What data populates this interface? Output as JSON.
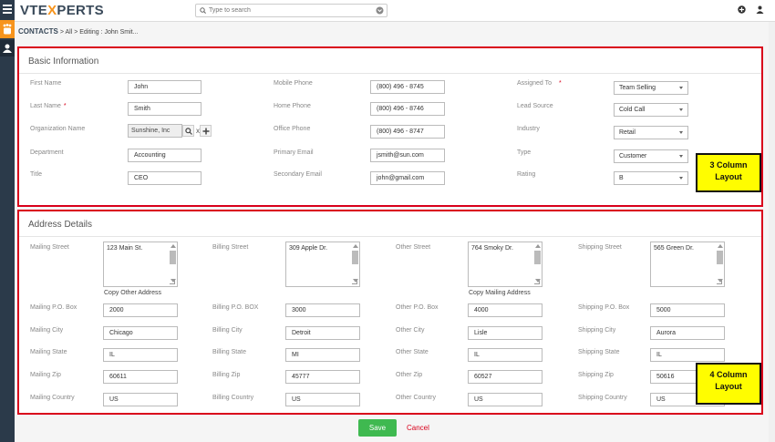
{
  "header": {
    "logo_left": "VTE",
    "logo_x": "X",
    "logo_right": "PERTS",
    "search_placeholder": "Type to search"
  },
  "breadcrumb": {
    "module": "CONTACTS",
    "sep1": ">",
    "all": "All",
    "sep2": ">",
    "current": "Editing : John Smit..."
  },
  "basic": {
    "title": "Basic Information",
    "first_name_label": "First Name",
    "first_name": "John",
    "last_name_label": "Last Name",
    "last_name": "Smith",
    "org_label": "Organization Name",
    "org": "Sunshine, Inc",
    "org_clear": "x",
    "department_label": "Department",
    "department": "Accounting",
    "title_label": "Title",
    "title_value": "CEO",
    "mobile_label": "Mobile Phone",
    "mobile": "(800) 496 - 8745",
    "home_label": "Home Phone",
    "home": "(800) 496 - 8746",
    "office_label": "Office Phone",
    "office": "(800) 496 - 8747",
    "primary_email_label": "Primary Email",
    "primary_email": "jsmith@sun.com",
    "secondary_email_label": "Secondary Email",
    "secondary_email": "john@gmail.com",
    "assigned_label": "Assigned To",
    "assigned": "Team Selling",
    "lead_source_label": "Lead Source",
    "lead_source": "Cold Call",
    "industry_label": "Industry",
    "industry": "Retail",
    "type_label": "Type",
    "type": "Customer",
    "rating_label": "Rating",
    "rating": "B",
    "required_mark": "*"
  },
  "address": {
    "title": "Address Details",
    "mailing_street_label": "Mailing Street",
    "mailing_street": "123 Main St.",
    "billing_street_label": "Billing Street",
    "billing_street": "309 Apple Dr.",
    "other_street_label": "Other Street",
    "other_street": "764 Smoky Dr.",
    "shipping_street_label": "Shipping Street",
    "shipping_street": "565 Green Dr.",
    "copy_other": "Copy Other Address",
    "copy_mailing": "Copy Mailing Address",
    "mailing_po_label": "Mailing P.O. Box",
    "mailing_po": "2000",
    "billing_po_label": "Billing P.O. BOX",
    "billing_po": "3000",
    "other_po_label": "Other P.O. Box",
    "other_po": "4000",
    "shipping_po_label": "Shipping P.O. Box",
    "shipping_po": "5000",
    "mailing_city_label": "Mailing City",
    "mailing_city": "Chicago",
    "billing_city_label": "Billing City",
    "billing_city": "Detroit",
    "other_city_label": "Other City",
    "other_city": "Lisle",
    "shipping_city_label": "Shipping City",
    "shipping_city": "Aurora",
    "mailing_state_label": "Mailing State",
    "mailing_state": "IL",
    "billing_state_label": "Billing State",
    "billing_state": "MI",
    "other_state_label": "Other State",
    "other_state": "IL",
    "shipping_state_label": "Shipping State",
    "shipping_state": "IL",
    "mailing_zip_label": "Mailing Zip",
    "mailing_zip": "60611",
    "billing_zip_label": "Billing Zip",
    "billing_zip": "45777",
    "other_zip_label": "Other Zip",
    "other_zip": "60527",
    "shipping_zip_label": "Shipping Zip",
    "shipping_zip": "50616",
    "mailing_country_label": "Mailing Country",
    "mailing_country": "US",
    "billing_country_label": "Billing Country",
    "billing_country": "US",
    "other_country_label": "Other Country",
    "other_country": "US",
    "shipping_country_label": "Shipping Country",
    "shipping_country": "US"
  },
  "callouts": {
    "three_col_line1": "3 Column",
    "three_col_line2": "Layout",
    "four_col_line1": "4 Column",
    "four_col_line2": "Layout"
  },
  "actions": {
    "save": "Save",
    "cancel": "Cancel"
  },
  "colors": {
    "accent_orange": "#f7941d",
    "save_green": "#3fb950",
    "annotation_red": "#d9001b",
    "callout_yellow": "#fffd00"
  },
  "icons": [
    "menu-icon",
    "cat-icon",
    "user-icon",
    "search-icon",
    "dropdown-icon",
    "plus-icon",
    "user-profile-icon"
  ]
}
